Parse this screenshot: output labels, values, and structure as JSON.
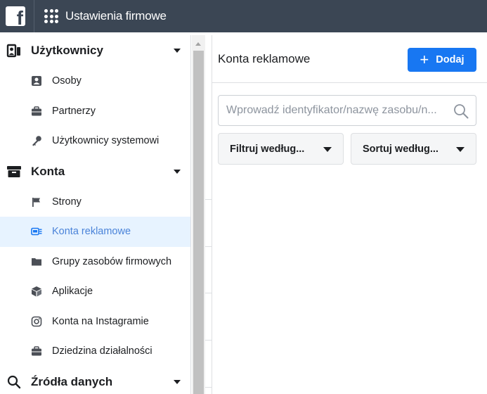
{
  "topbar": {
    "logo_letter": "f",
    "title": "Ustawienia firmowe"
  },
  "sidebar": {
    "sections": [
      {
        "label": "Użytkownicy",
        "icon": "users-icon",
        "items": [
          {
            "label": "Osoby",
            "icon": "person-card-icon"
          },
          {
            "label": "Partnerzy",
            "icon": "briefcase-icon"
          },
          {
            "label": "Użytkownicy systemowi",
            "icon": "key-icon"
          }
        ]
      },
      {
        "label": "Konta",
        "icon": "archive-box-icon",
        "items": [
          {
            "label": "Strony",
            "icon": "flag-icon"
          },
          {
            "label": "Konta reklamowe",
            "icon": "ad-account-icon",
            "active": true
          },
          {
            "label": "Grupy zasobów firmowych",
            "icon": "folder-icon"
          },
          {
            "label": "Aplikacje",
            "icon": "cube-icon"
          },
          {
            "label": "Konta na Instagramie",
            "icon": "instagram-icon"
          },
          {
            "label": "Dziedzina działalności",
            "icon": "briefcase-icon"
          }
        ]
      },
      {
        "label": "Źródła danych",
        "icon": "search-icon"
      }
    ]
  },
  "main": {
    "title": "Konta reklamowe",
    "add_button": {
      "plus": "+",
      "label": "Dodaj"
    },
    "search": {
      "placeholder": "Wprowadź identyfikator/nazwę zasobu/n..."
    },
    "filter_label": "Filtruj według...",
    "sort_label": "Sortuj według..."
  },
  "colors": {
    "topbar": "#3b4654",
    "accent": "#1877f2",
    "active_bg": "#e7f3ff",
    "active_text": "#4a83d9"
  }
}
